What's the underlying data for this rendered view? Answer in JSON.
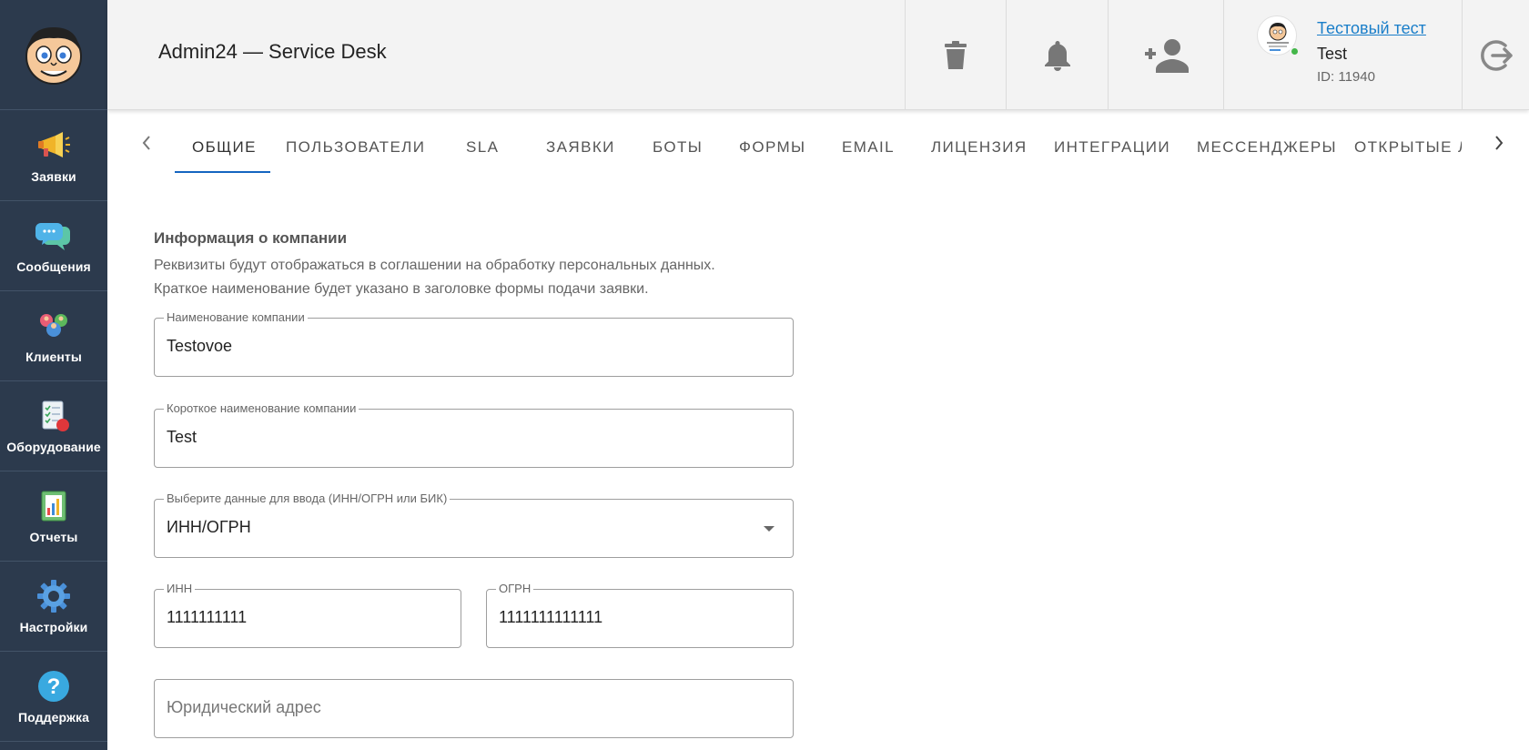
{
  "sidebar": {
    "items": [
      {
        "label": "Заявки",
        "icon": "megaphone-icon"
      },
      {
        "label": "Сообщения",
        "icon": "chat-bubbles-icon"
      },
      {
        "label": "Клиенты",
        "icon": "users-group-icon"
      },
      {
        "label": "Оборудование",
        "icon": "equipment-checklist-icon"
      },
      {
        "label": "Отчеты",
        "icon": "report-chart-icon"
      },
      {
        "label": "Настройки",
        "icon": "gear-icon"
      },
      {
        "label": "Поддержка",
        "icon": "help-question-icon"
      }
    ]
  },
  "header": {
    "title": "Admin24 — Service Desk",
    "user": {
      "name": "Тестовый тест",
      "login": "Test",
      "id": "ID: 11940",
      "status": "online"
    }
  },
  "tabs": {
    "items": [
      "Общие",
      "Пользователи",
      "SLA",
      "Заявки",
      "Боты",
      "Формы",
      "Email",
      "Лицензия",
      "Интеграции",
      "Мессенджеры",
      "Открытые линии"
    ],
    "active": "Общие"
  },
  "section": {
    "title": "Информация о компании",
    "desc1": "Реквизиты будут отображаться в соглашении на обработку персональных данных.",
    "desc2": "Краткое наименование будет указано в заголовке формы подачи заявки."
  },
  "form": {
    "company_name": {
      "label": "Наименование компании",
      "value": "Testovoe"
    },
    "short_name": {
      "label": "Короткое наименование компании",
      "value": "Test"
    },
    "data_type": {
      "label": "Выберите данные для ввода (ИНН/ОГРН или БИК)",
      "value": "ИНН/ОГРН"
    },
    "inn": {
      "label": "ИНН",
      "value": "1111111111"
    },
    "ogrn": {
      "label": "ОГРН",
      "value": "1111111111111"
    },
    "legal_address": {
      "placeholder": "Юридический адрес"
    }
  },
  "colors": {
    "sidebar_bg": "#2c3a4d",
    "header_bg": "#f3f3f3",
    "accent": "#1565c0",
    "link": "#1a7ec9",
    "online": "#43b649"
  }
}
